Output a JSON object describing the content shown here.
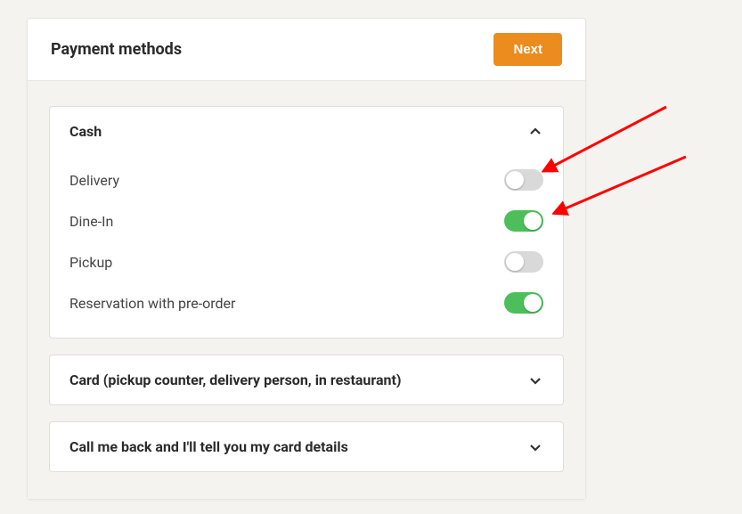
{
  "header": {
    "title": "Payment methods",
    "next_label": "Next"
  },
  "sections": {
    "cash": {
      "title": "Cash",
      "expanded": true,
      "rows": [
        {
          "label": "Delivery",
          "on": false
        },
        {
          "label": "Dine-In",
          "on": true
        },
        {
          "label": "Pickup",
          "on": false
        },
        {
          "label": "Reservation with pre-order",
          "on": true
        }
      ]
    },
    "card": {
      "title": "Card (pickup counter, delivery person, in restaurant)",
      "expanded": false
    },
    "callback": {
      "title": "Call me back and I'll tell you my card details",
      "expanded": false
    }
  },
  "colors": {
    "accent": "#ec8b1e",
    "toggle_on": "#4cbf5a",
    "toggle_off": "#d9d9d9",
    "arrow": "#ff0000"
  }
}
